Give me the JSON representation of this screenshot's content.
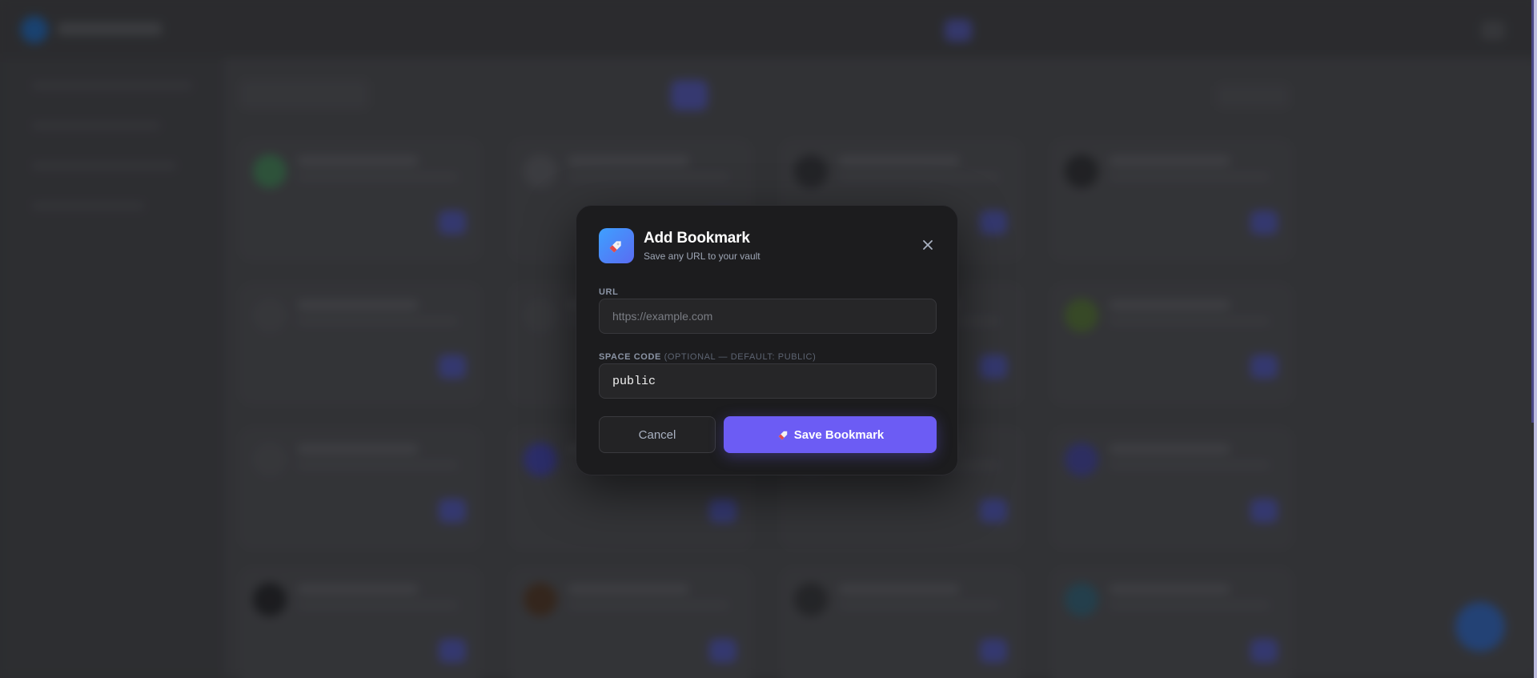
{
  "modal": {
    "title": "Add Bookmark",
    "subtitle": "Save any URL to your vault",
    "icon": "bookmark-tag-icon",
    "close_icon": "close-icon"
  },
  "url_field": {
    "label": "URL",
    "placeholder": "https://example.com",
    "value": ""
  },
  "space_field": {
    "label": "SPACE CODE",
    "optional_note": "(OPTIONAL — DEFAULT: PUBLIC)",
    "value": "public"
  },
  "actions": {
    "cancel_label": "Cancel",
    "save_label": "Save Bookmark",
    "save_icon": "bookmark-tag-icon"
  },
  "colors": {
    "accent": "#6c5cf4",
    "modal_bg": "#1c1c1e",
    "icon_gradient_start": "#3ea0ff",
    "icon_gradient_end": "#5a6cf2"
  }
}
